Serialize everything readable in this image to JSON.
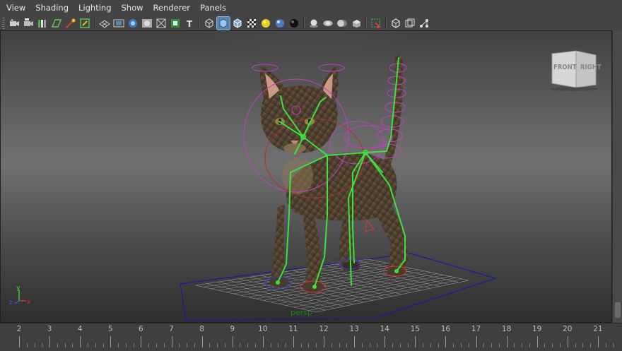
{
  "menu": [
    "View",
    "Shading",
    "Lighting",
    "Show",
    "Renderer",
    "Panels"
  ],
  "toolbar": {
    "groups": [
      [
        "select-camera-icon",
        "camera-attributes-icon",
        "bookmarks-icon",
        "image-plane-icon",
        "2d-pan-zoom-icon",
        "grease-pencil-icon"
      ],
      [
        "grid-icon",
        "film-gate-icon",
        "resolution-gate-icon",
        "gate-mask-icon",
        "field-chart-icon",
        "safe-action-icon"
      ],
      [
        "wireframe-icon",
        "smooth-shade-icon",
        "wireframe-on-shaded-icon",
        "textured-icon",
        "use-lights-icon",
        "shadows-icon"
      ],
      [
        "screen-space-ao-icon",
        "motion-blur-icon",
        "multisample-aa-icon",
        "depth-of-field-icon"
      ],
      [
        "isolate-select-icon",
        "xray-icon",
        "xray-active-components-icon",
        "xray-joints-icon"
      ]
    ],
    "active": "smooth-shade-icon"
  },
  "viewport": {
    "camera_label": "persp",
    "viewcube": {
      "left_face": "FRONT",
      "right_face": "RIGHT"
    },
    "axis": {
      "x": "x",
      "y": "y",
      "z": "z"
    },
    "colors": {
      "skeleton": "#3fe03f",
      "ik_handles": "#c23fc2",
      "ground_box": "#1c1c9a",
      "grid": "#9a9a9a"
    }
  },
  "timeslider": {
    "ticks": [
      "2",
      "3",
      "4",
      "5",
      "6",
      "7",
      "8",
      "9",
      "10",
      "11",
      "12",
      "13",
      "14",
      "15",
      "16",
      "17",
      "18",
      "19",
      "20",
      "21"
    ]
  }
}
